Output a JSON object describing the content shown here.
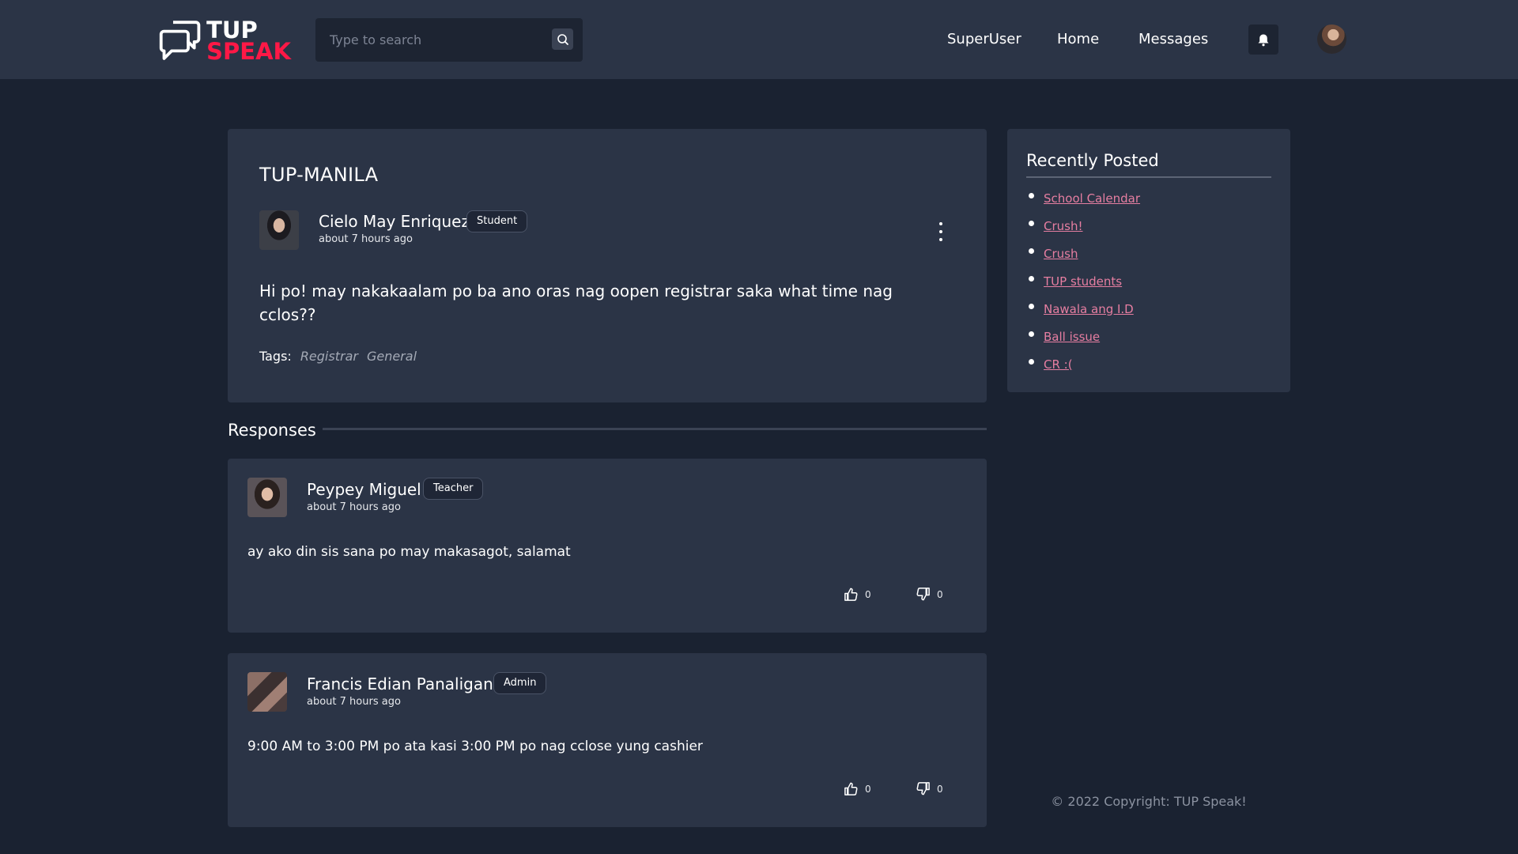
{
  "header": {
    "logo_line1": "TUP",
    "logo_line2": "SPEAK",
    "search_placeholder": "Type to search",
    "nav": [
      "SuperUser",
      "Home",
      "Messages"
    ]
  },
  "post": {
    "title": "TUP-MANILA",
    "author": "Cielo May Enriquez",
    "role": "Student",
    "time": "about 7 hours ago",
    "body": "Hi po! may nakakaalam po ba ano oras nag oopen registrar saka what time nag cclos??",
    "tags_label": "Tags:",
    "tags": [
      "Registrar",
      "General"
    ]
  },
  "responses": {
    "label": "Responses",
    "items": [
      {
        "author": "Peypey Miguel",
        "role": "Teacher",
        "time": "about 7 hours ago",
        "body": "ay ako din sis sana po may makasagot, salamat",
        "likes": "0",
        "dislikes": "0"
      },
      {
        "author": "Francis Edian Panaligan",
        "role": "Admin",
        "time": "about 7 hours ago",
        "body": "9:00 AM to 3:00 PM po ata kasi 3:00 PM po nag cclose yung cashier",
        "likes": "0",
        "dislikes": "0"
      }
    ]
  },
  "sidebar": {
    "title": "Recently Posted",
    "items": [
      "School Calendar",
      "Crush!",
      "Crush",
      "TUP students",
      "Nawala ang I.D",
      "Ball issue",
      "CR :("
    ]
  },
  "footer": "© 2022 Copyright: TUP Speak!",
  "colors": {
    "background": "#1a2231",
    "card": "#2b3446",
    "accent": "#ff1846",
    "link": "#e67ea1"
  },
  "icons": [
    "logo-chat-icon",
    "search-icon",
    "bell-icon",
    "kebab-icon",
    "thumbs-up-icon",
    "thumbs-down-icon"
  ]
}
